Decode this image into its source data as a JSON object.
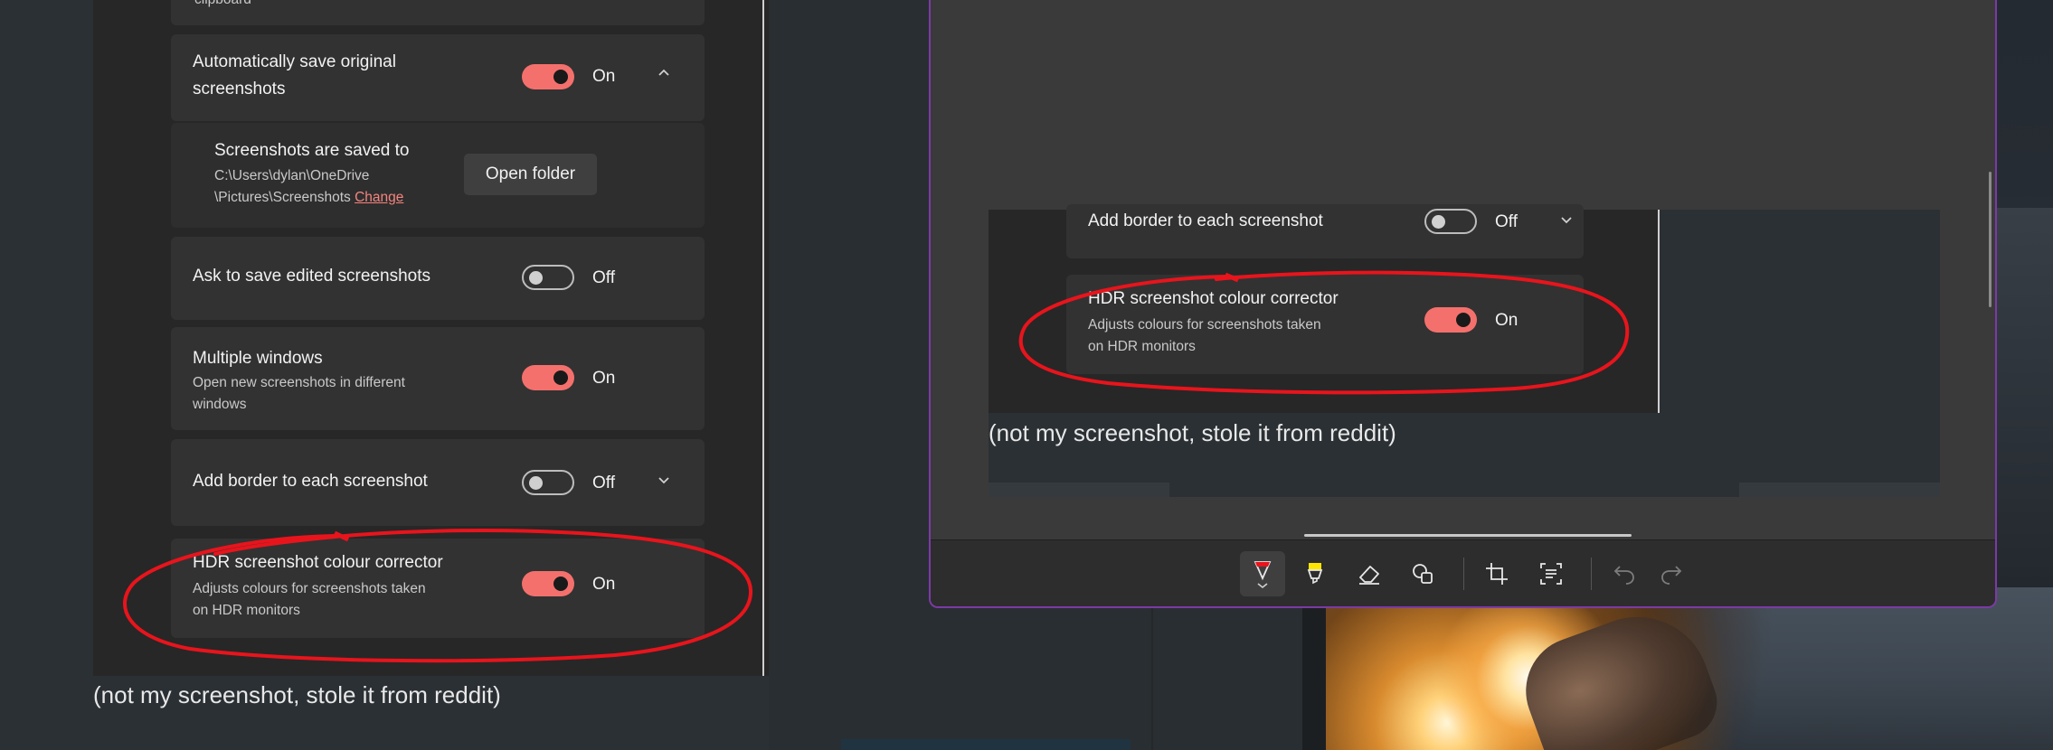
{
  "left_settings": {
    "top_partial_text": "clipboard",
    "auto_save": {
      "title_line1": "Automatically save original",
      "title_line2": "screenshots",
      "state": "On"
    },
    "saved_to": {
      "title": "Screenshots are saved to",
      "path_line1": "C:\\Users\\dylan\\OneDrive",
      "path_line2": "\\Pictures\\Screenshots",
      "change_link": "Change",
      "open_folder_button": "Open folder"
    },
    "ask_save": {
      "title": "Ask to save edited screenshots",
      "state": "Off"
    },
    "multiple_windows": {
      "title": "Multiple windows",
      "desc_line1": "Open new screenshots in different",
      "desc_line2": "windows",
      "state": "On"
    },
    "add_border": {
      "title": "Add border to each screenshot",
      "state": "Off"
    },
    "hdr": {
      "title": "HDR screenshot colour corrector",
      "desc_line1": "Adjusts colours for screenshots taken",
      "desc_line2": "on HDR monitors",
      "state": "On"
    }
  },
  "left_caption": "(not my screenshot, stole it from reddit)",
  "snip_window": {
    "inner_settings": {
      "add_border": {
        "title": "Add border to each screenshot",
        "state": "Off"
      },
      "hdr": {
        "title": "HDR screenshot colour corrector",
        "desc_line1": "Adjusts colours for screenshots taken",
        "desc_line2": "on HDR monitors",
        "state": "On"
      }
    },
    "inner_caption": "(not my screenshot, stole it from reddit)",
    "toolbar": {
      "tools": [
        "ballpoint-pen-icon",
        "highlighter-icon",
        "eraser-icon",
        "shapes-icon",
        "crop-icon",
        "text-actions-icon",
        "undo-icon",
        "redo-icon"
      ],
      "selected_tool": "ballpoint-pen-icon"
    }
  },
  "colors": {
    "toggle_on": "#f4706c",
    "annotation_red": "#e8141c",
    "highlighter_yellow": "#ffe600",
    "window_border": "#7c3aa6"
  }
}
